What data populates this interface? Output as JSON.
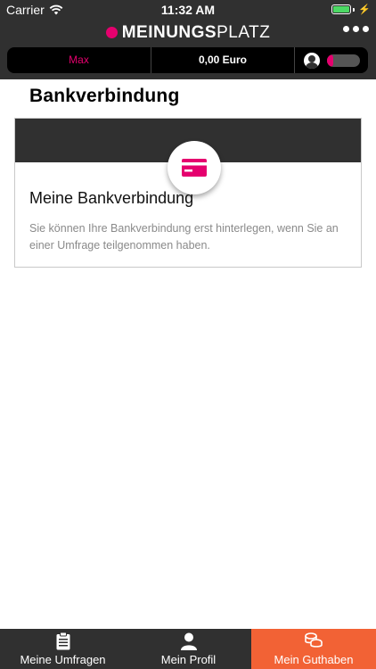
{
  "status_bar": {
    "carrier": "Carrier",
    "time": "11:32 AM"
  },
  "header": {
    "logo_bold": "MEINUNGS",
    "logo_light": "PLATZ",
    "user_name": "Max",
    "balance": "0,00 Euro",
    "profile_progress": 0.2
  },
  "page": {
    "title": "Bankverbindung"
  },
  "card": {
    "icon": "credit-card-icon",
    "title": "Meine Bankverbindung",
    "text": "Sie können Ihre Bankverbindung erst hinterlegen, wenn Sie an einer Umfrage teilgenommen haben."
  },
  "tabs": [
    {
      "label": "Meine Umfragen",
      "icon": "clipboard-icon",
      "active": false
    },
    {
      "label": "Mein Profil",
      "icon": "person-icon",
      "active": false
    },
    {
      "label": "Mein Guthaben",
      "icon": "coins-icon",
      "active": true
    }
  ],
  "colors": {
    "brand": "#e5006e",
    "dark": "#303030",
    "active_tab": "#f26235"
  }
}
